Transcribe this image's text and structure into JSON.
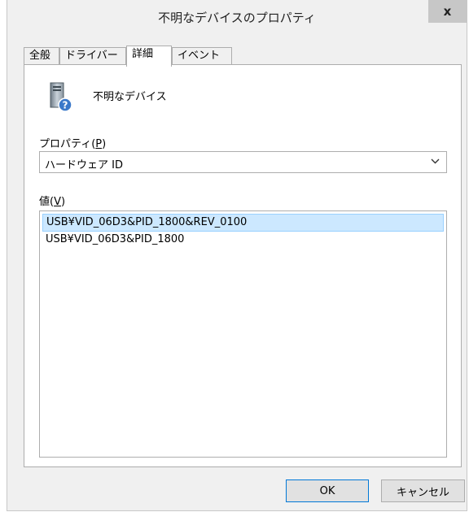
{
  "window": {
    "title": "不明なデバイスのプロパティ",
    "close_label": "x"
  },
  "tabs": [
    {
      "label": "全般"
    },
    {
      "label": "ドライバー"
    },
    {
      "label": "詳細"
    },
    {
      "label": "イベント"
    }
  ],
  "active_tab": "詳細",
  "device": {
    "icon": "unknown-device-icon",
    "name": "不明なデバイス"
  },
  "property": {
    "label_text": "プロパティ(",
    "accel": "P",
    "label_close": ")",
    "selected": "ハードウェア ID"
  },
  "value": {
    "label_text": "値(",
    "accel": "V",
    "label_close": ")",
    "items": [
      "USB¥VID_06D3&PID_1800&REV_0100",
      "USB¥VID_06D3&PID_1800"
    ]
  },
  "buttons": {
    "ok": "OK",
    "cancel": "キャンセル"
  }
}
